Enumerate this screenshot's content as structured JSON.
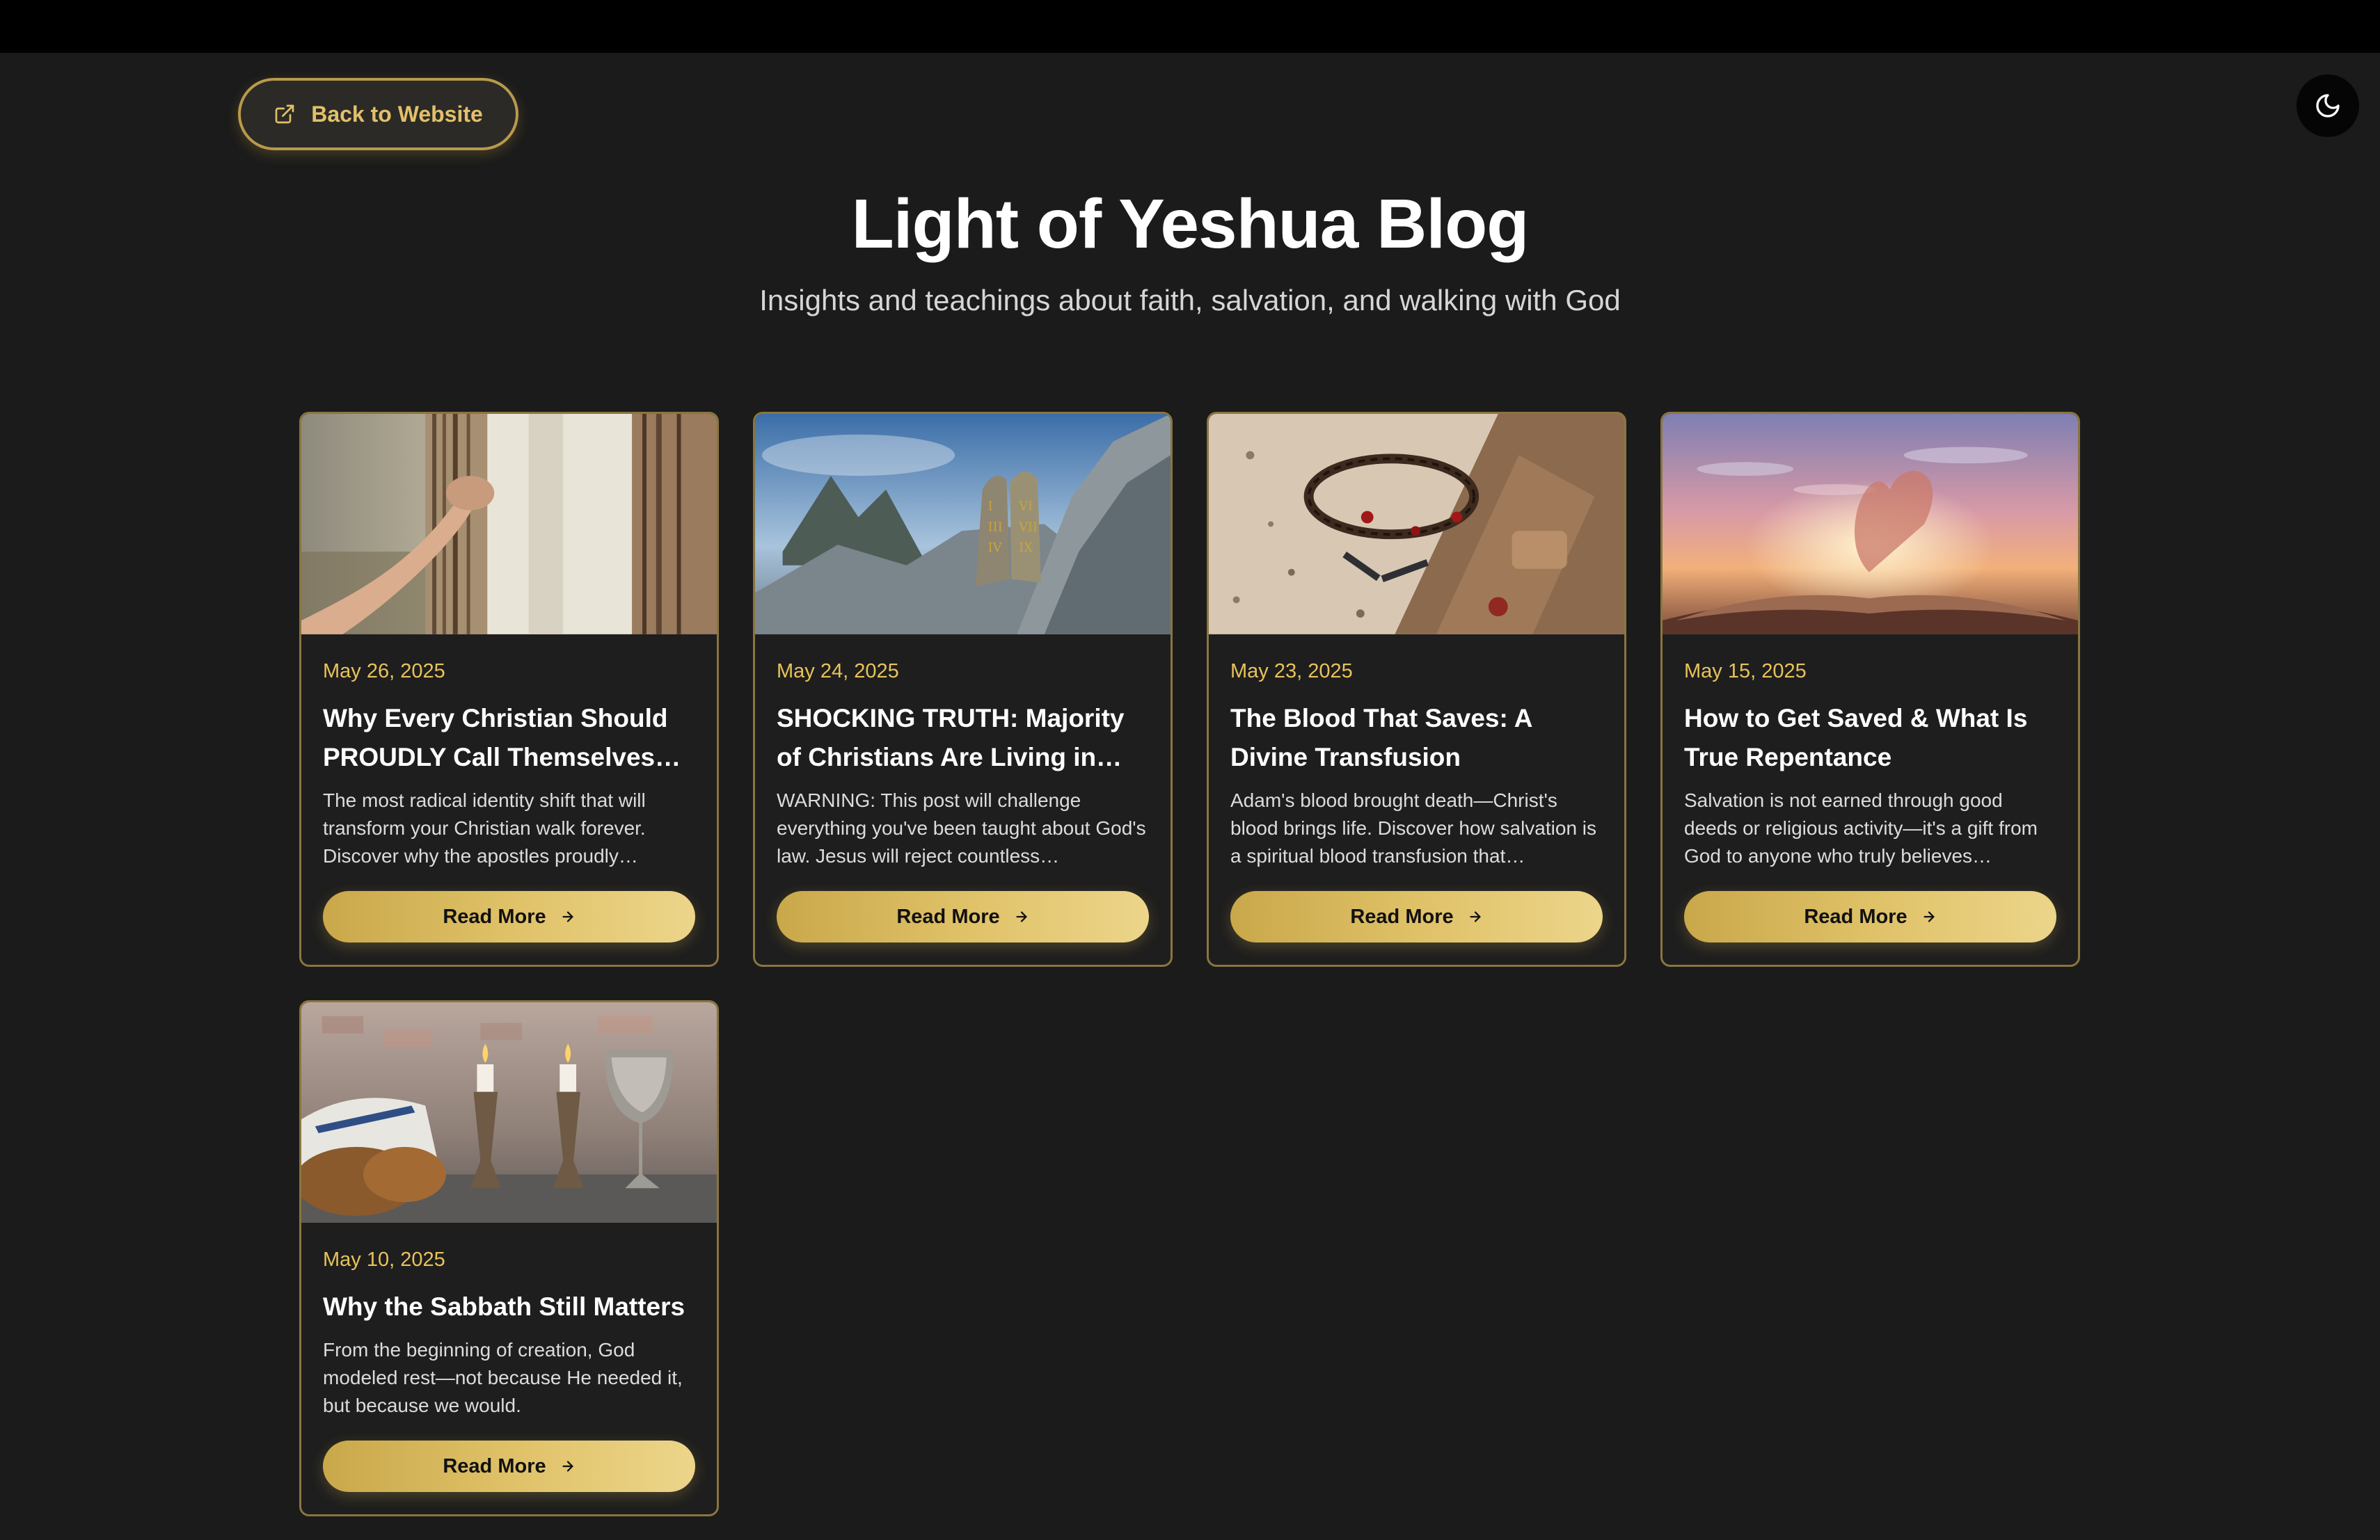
{
  "header": {
    "back_label": "Back to Website",
    "title": "Light of Yeshua Blog",
    "subtitle": "Insights and teachings about faith, salvation, and walking with God"
  },
  "icons": {
    "back": "external-link-icon",
    "theme": "moon-icon",
    "arrow": "arrow-right-icon"
  },
  "colors": {
    "accent": "#e8c35a",
    "button_gold_start": "#c9a84a",
    "button_gold_end": "#ecd58a",
    "background": "#1b1b1b",
    "card_border": "#8a7540"
  },
  "posts": [
    {
      "date": "May 26, 2025",
      "title": "Why Every Christian Should PROUDLY Call Themselves a…",
      "excerpt": "The most radical identity shift that will transform your Christian walk forever. Discover why the apostles proudly…",
      "cta": "Read More"
    },
    {
      "date": "May 24, 2025",
      "title": "SHOCKING TRUTH: Majority of Christians Are Living in…",
      "excerpt": "WARNING: This post will challenge everything you've been taught about God's law. Jesus will reject countless…",
      "cta": "Read More"
    },
    {
      "date": "May 23, 2025",
      "title": "The Blood That Saves: A Divine Transfusion",
      "excerpt": "Adam's blood brought death—Christ's blood brings life. Discover how salvation is a spiritual blood transfusion that…",
      "cta": "Read More"
    },
    {
      "date": "May 15, 2025",
      "title": "How to Get Saved & What Is True Repentance",
      "excerpt": "Salvation is not earned through good deeds or religious activity—it's a gift from God to anyone who truly believes…",
      "cta": "Read More"
    },
    {
      "date": "May 10, 2025",
      "title": "Why the Sabbath Still Matters",
      "excerpt": "From the beginning of creation, God modeled rest—not because He needed it, but because we would.",
      "cta": "Read More"
    }
  ]
}
